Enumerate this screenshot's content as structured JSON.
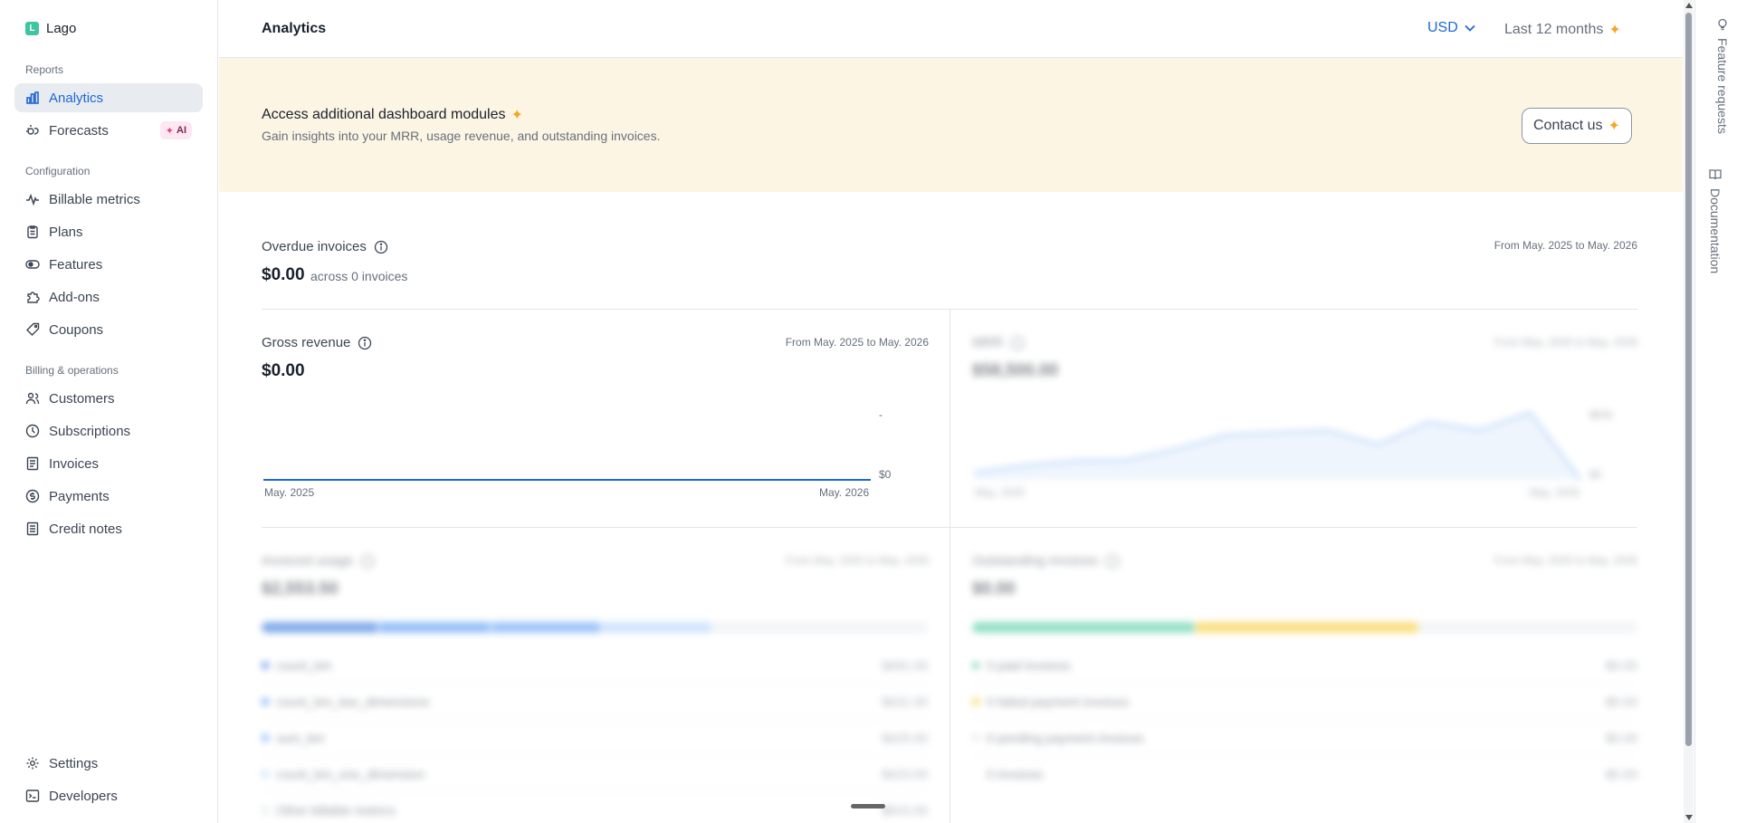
{
  "org": {
    "initial": "L",
    "name": "Lago"
  },
  "sidebar": {
    "sections": {
      "reports": "Reports",
      "configuration": "Configuration",
      "billing": "Billing & operations"
    },
    "reports": [
      {
        "label": "Analytics",
        "icon": "bar-chart-icon",
        "active": true
      },
      {
        "label": "Forecasts",
        "icon": "forecast-icon",
        "badge": "AI"
      }
    ],
    "configuration": [
      {
        "label": "Billable metrics",
        "icon": "pulse-icon"
      },
      {
        "label": "Plans",
        "icon": "clipboard-icon"
      },
      {
        "label": "Features",
        "icon": "toggle-icon"
      },
      {
        "label": "Add-ons",
        "icon": "puzzle-icon"
      },
      {
        "label": "Coupons",
        "icon": "tag-icon"
      }
    ],
    "billing": [
      {
        "label": "Customers",
        "icon": "users-icon"
      },
      {
        "label": "Subscriptions",
        "icon": "clock-icon"
      },
      {
        "label": "Invoices",
        "icon": "document-icon"
      },
      {
        "label": "Payments",
        "icon": "coin-icon"
      },
      {
        "label": "Credit notes",
        "icon": "receipt-icon"
      }
    ],
    "bottom": [
      {
        "label": "Settings",
        "icon": "gear-icon"
      },
      {
        "label": "Developers",
        "icon": "terminal-icon"
      }
    ]
  },
  "header": {
    "title": "Analytics",
    "currency": "USD",
    "period": "Last 12 months"
  },
  "banner": {
    "title": "Access additional dashboard modules",
    "subtitle": "Gain insights into your MRR, usage revenue, and outstanding invoices.",
    "cta": "Contact us"
  },
  "overdue": {
    "title": "Overdue invoices",
    "range": "From May. 2025 to May. 2026",
    "amount": "$0.00",
    "count": "across 0 invoices"
  },
  "gross_revenue": {
    "title": "Gross revenue",
    "range": "From May. 2025 to May. 2026",
    "amount": "$0.00",
    "y_top": "-",
    "y_bottom": "$0",
    "x_start": "May. 2025",
    "x_end": "May. 2026"
  },
  "mrr": {
    "title": "MRR",
    "range": "From May. 2025 to May. 2026",
    "amount": "$58,500.00",
    "y_top": "$60k",
    "y_bottom": "$0",
    "x_start": "May. 2025",
    "x_end": "May. 2026"
  },
  "invoiced_usage": {
    "title": "Invoiced usage",
    "range": "From May. 2025 to May. 2026",
    "amount": "$2,553.50",
    "items": [
      {
        "label": "count_bm",
        "value": "$491.00",
        "color": "#1d67d6"
      },
      {
        "label": "count_bm_two_dimensions",
        "value": "$431.00",
        "color": "#3d8bf2"
      },
      {
        "label": "sum_bm",
        "value": "$425.00",
        "color": "#4f95f5"
      },
      {
        "label": "count_bm_one_dimension",
        "value": "$423.00",
        "color": "#a9cdfb"
      },
      {
        "label": "Other billable metrics",
        "value": "$815.00",
        "color": "#d8dde3"
      }
    ]
  },
  "outstanding": {
    "title": "Outstanding invoices",
    "range": "From May. 2025 to May. 2026",
    "amount": "$0.00",
    "items": [
      {
        "label": "0 paid invoices",
        "value": "$0.00",
        "color": "#3fc59a"
      },
      {
        "label": "0 failed payment invoices",
        "value": "$0.00",
        "color": "#f5c518"
      },
      {
        "label": "0 pending payment invoices",
        "value": "$0.00",
        "color": "#d8dde3"
      },
      {
        "label": "0 invoices",
        "value": "$0.00",
        "color": "#ffffff"
      }
    ]
  },
  "side_tabs": {
    "feature_requests": "Feature requests",
    "documentation": "Documentation"
  },
  "chart_data": [
    {
      "type": "line",
      "title": "Gross revenue",
      "x": [
        "May. 2025",
        "May. 2026"
      ],
      "series": [
        {
          "values": [
            0,
            0
          ]
        }
      ],
      "ylabel": "",
      "xlabel": ""
    },
    {
      "type": "area",
      "title": "MRR",
      "x": [
        "May. 2025",
        "",
        "",
        "",
        "",
        "",
        "",
        "",
        "",
        "",
        "",
        "May. 2026"
      ],
      "series": [
        {
          "values": [
            6000,
            12000,
            16000,
            16500,
            26000,
            38000,
            40000,
            42000,
            30000,
            49000,
            42000,
            57000,
            0
          ]
        }
      ],
      "ylim": [
        0,
        60000
      ]
    }
  ]
}
